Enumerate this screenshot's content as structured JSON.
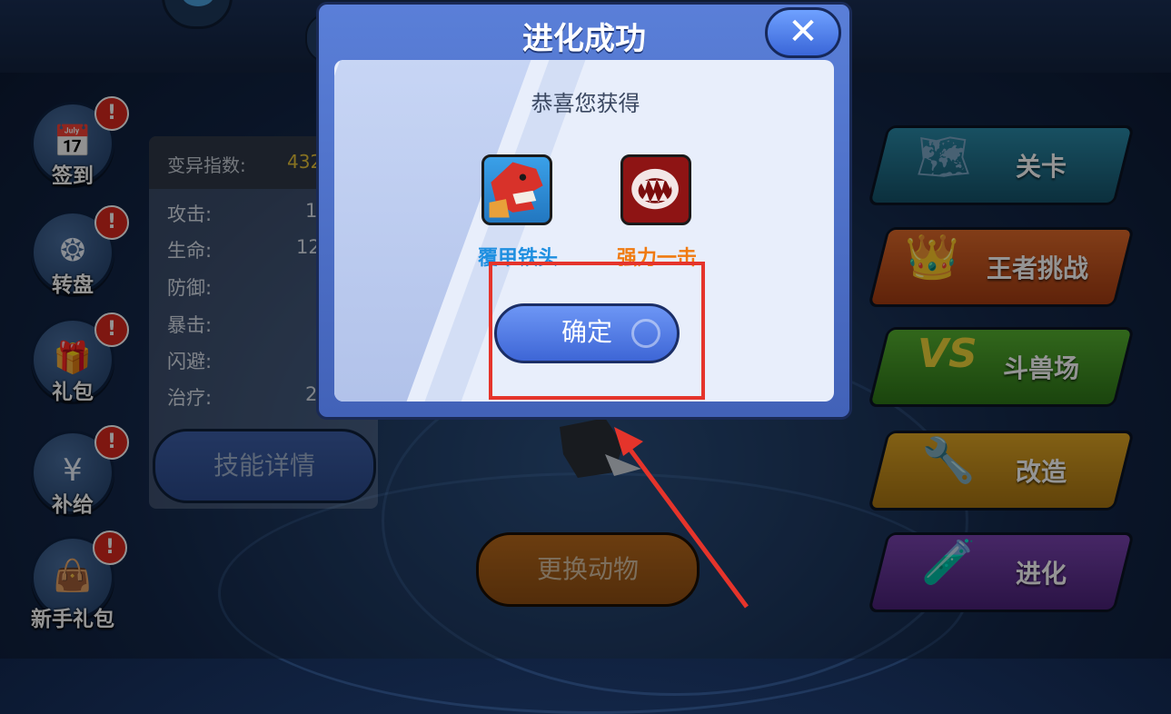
{
  "left_menu": [
    {
      "label": "签到",
      "icon": "calendar-icon",
      "glyph": "📅",
      "badge": "!"
    },
    {
      "label": "转盘",
      "icon": "wheel-icon",
      "glyph": "❂",
      "badge": "!"
    },
    {
      "label": "礼包",
      "icon": "gift-icon",
      "glyph": "🎁",
      "badge": "!"
    },
    {
      "label": "补给",
      "icon": "money-bag-icon",
      "glyph": "¥",
      "badge": "!"
    },
    {
      "label": "新手礼包",
      "icon": "shopping-bag-icon",
      "glyph": "👜",
      "badge": "!"
    }
  ],
  "stats": {
    "mutation_label": "变异指数:",
    "mutation_value": "432",
    "rows": [
      {
        "label": "攻击:",
        "value": "1"
      },
      {
        "label": "生命:",
        "value": "12"
      },
      {
        "label": "防御:",
        "value": ""
      },
      {
        "label": "暴击:",
        "value": ""
      },
      {
        "label": "闪避:",
        "value": ""
      },
      {
        "label": "治疗:",
        "value": "2"
      }
    ]
  },
  "skill_detail_label": "技能详情",
  "change_animal_label": "更换动物",
  "right_menu": [
    {
      "label": "关卡",
      "icon": "map-icon",
      "glyph": "🗺",
      "color": "#1f6e8a"
    },
    {
      "label": "王者挑战",
      "icon": "crown-icon",
      "glyph": "👑",
      "color": "#c0531b"
    },
    {
      "label": "斗兽场",
      "icon": "vs-icon",
      "glyph": "VS",
      "color": "#3e8f22"
    },
    {
      "label": "改造",
      "icon": "tools-icon",
      "glyph": "🔧",
      "color": "#c08a12"
    },
    {
      "label": "进化",
      "icon": "potion-icon",
      "glyph": "🧪",
      "color": "#5d2e8c"
    }
  ],
  "dialog": {
    "title": "进化成功",
    "close_label": "✕",
    "congrats": "恭喜您获得",
    "rewards": [
      {
        "name": "覆甲铁头",
        "icon": "armored-dragon-icon",
        "name_color": "#1f8fe0"
      },
      {
        "name": "强力一击",
        "icon": "bite-icon",
        "name_color": "#f07a10"
      }
    ],
    "confirm_label": "确定"
  },
  "colors": {
    "highlight": "#e5342b",
    "modal_blue": "#4f72cc"
  }
}
